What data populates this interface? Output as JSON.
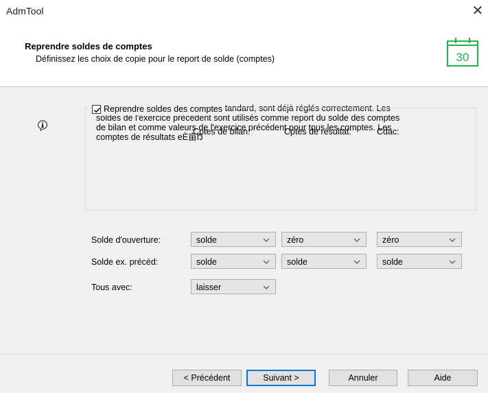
{
  "window": {
    "title": "AdmTool",
    "close_glyph": "✕"
  },
  "header": {
    "title": "Reprendre soldes de comptes",
    "subtitle": "Définissez les choix de copie pour le report de solde (comptes)",
    "calendar_number": "30",
    "calendar_color": "#21b24b"
  },
  "info": {
    "line1": "Les choix de copies, pour le cas standard, sont déjà réglés correctement. Les",
    "line2": "soldes de l'exercice précédent sont utilisés comme report du solde des comptes",
    "line3": "de bilan et comme valeurs de l'exercice précédent pour tous les comptes. Les",
    "line4": "comptes de résultats eÈ亩Ŋ"
  },
  "group": {
    "checkbox_label": "Reprendre soldes des comptes",
    "checked": true,
    "columns": [
      "Cptes de bilan:",
      "Cptes de résultat:",
      "Cdac:"
    ],
    "rows": [
      {
        "label": "Solde d'ouverture:",
        "values": [
          "solde",
          "zéro",
          "zéro"
        ]
      },
      {
        "label": "Solde ex. précéd:",
        "values": [
          "solde",
          "solde",
          "solde"
        ]
      },
      {
        "label": "Tous avec:",
        "values": [
          "laisser"
        ]
      }
    ]
  },
  "footer": {
    "prev": "< Précédent",
    "next": "Suivant >",
    "cancel": "Annuler",
    "help": "Aide"
  }
}
